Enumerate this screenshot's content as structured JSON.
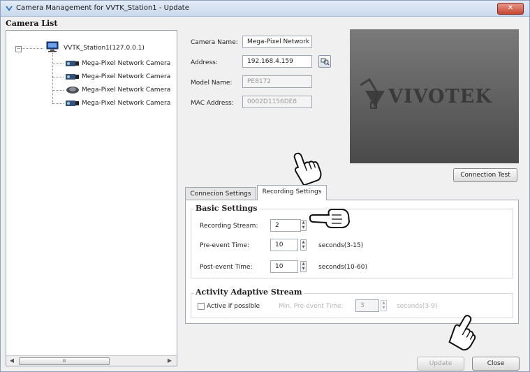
{
  "window": {
    "title": "Camera Management for VVTK_Station1 - Update",
    "close_glyph": "✕"
  },
  "camera_list": {
    "title": "Camera List",
    "root": "VVTK_Station1(127.0.0.1)",
    "cameras": [
      "Mega-Pixel Network Camera",
      "Mega-Pixel Network Camera",
      "Mega-Pixel Network Camera",
      "Mega-Pixel Network Camera"
    ],
    "scroll_left": "◀",
    "scroll_thumb": "III",
    "scroll_right": "▶"
  },
  "details": {
    "camera_name_label": "Camera Name:",
    "camera_name_value": "Mega-Pixel Network",
    "address_label": "Address:",
    "address_value": "192.168.4.159",
    "model_name_label": "Model Name:",
    "model_name_value": "PE8172",
    "mac_address_label": "MAC Address:",
    "mac_address_value": "0002D1156DE8"
  },
  "preview": {
    "logo_text": "VIVOTEK"
  },
  "connection_test_label": "Connection Test",
  "tabs": [
    {
      "label": "Connecion Settings",
      "active": false
    },
    {
      "label": "Recording Settings",
      "active": true
    }
  ],
  "basic_settings": {
    "title": "Basic Settings",
    "recording_stream_label": "Recording Stream:",
    "recording_stream_value": "2",
    "pre_event_label": "Pre-event Time:",
    "pre_event_value": "10",
    "pre_event_unit": "seconds(3-15)",
    "post_event_label": "Post-event Time:",
    "post_event_value": "10",
    "post_event_unit": "seconds(10-60)"
  },
  "activity_stream": {
    "title": "Activity Adaptive Stream",
    "active_label": "Active if possible",
    "active_checked": false,
    "min_pre_event_label": "Min. Pre-event Time:",
    "min_pre_event_value": "3",
    "min_pre_event_unit": "seconds(3-9)"
  },
  "buttons": {
    "update": "Update",
    "close": "Close"
  },
  "spinner_up": "▲",
  "spinner_down": "▼",
  "colors": {
    "title_bar": "#c9d8ec",
    "close_button": "#c7452f",
    "preview_bg": "#5a5a5a"
  }
}
